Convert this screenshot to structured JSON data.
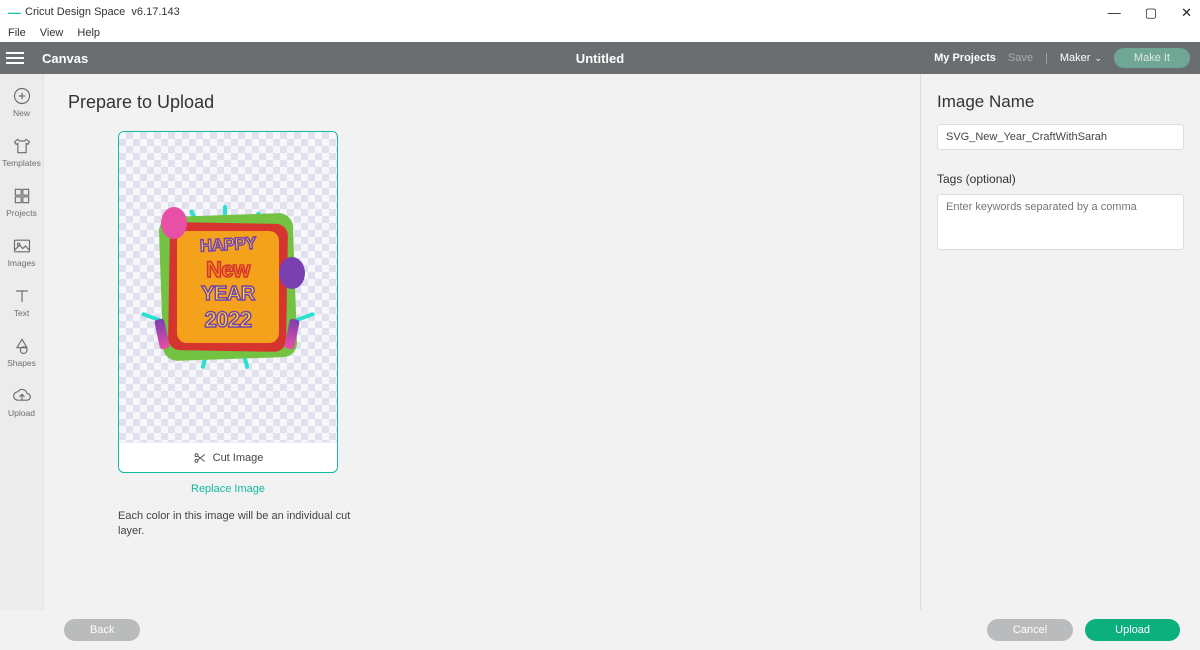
{
  "window": {
    "app_title": "Cricut Design Space",
    "version": "v6.17.143"
  },
  "menubar": {
    "items": [
      "File",
      "View",
      "Help"
    ]
  },
  "topbar": {
    "canvas": "Canvas",
    "doc_title": "Untitled",
    "my_projects": "My Projects",
    "save": "Save",
    "maker": "Maker",
    "make_it": "Make It"
  },
  "sidebar": {
    "items": [
      {
        "label": "New"
      },
      {
        "label": "Templates"
      },
      {
        "label": "Projects"
      },
      {
        "label": "Images"
      },
      {
        "label": "Text"
      },
      {
        "label": "Shapes"
      },
      {
        "label": "Upload"
      }
    ]
  },
  "main": {
    "heading": "Prepare to Upload",
    "cut_image": "Cut Image",
    "replace_image": "Replace Image",
    "description": "Each color in this image will be an individual cut layer.",
    "artwork_text": {
      "l1": "HAPPY",
      "l2": "New",
      "l3": "YEAR",
      "l4": "2022"
    }
  },
  "rightpane": {
    "image_name_label": "Image Name",
    "image_name_value": "SVG_New_Year_CraftWithSarah",
    "tags_label": "Tags (optional)",
    "tags_placeholder": "Enter keywords separated by a comma"
  },
  "footer": {
    "back": "Back",
    "cancel": "Cancel",
    "upload": "Upload"
  }
}
